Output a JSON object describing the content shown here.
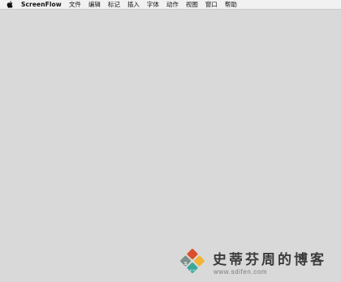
{
  "menubar": {
    "apple_icon": "apple-icon",
    "app_name": "ScreenFlow",
    "items": [
      "文件",
      "编辑",
      "标记",
      "插入",
      "字体",
      "动作",
      "视图",
      "窗口",
      "帮助"
    ]
  },
  "watermark": {
    "title": "史蒂芬周的博客",
    "url": "www.sdifen.com",
    "logo_colors": [
      "#d94f2b",
      "#f3b335",
      "#3aa79a",
      "#7d8f8b"
    ]
  },
  "colors": {
    "desktop_background": "#d9d9d9",
    "menubar_background": "#f1f1f1"
  }
}
